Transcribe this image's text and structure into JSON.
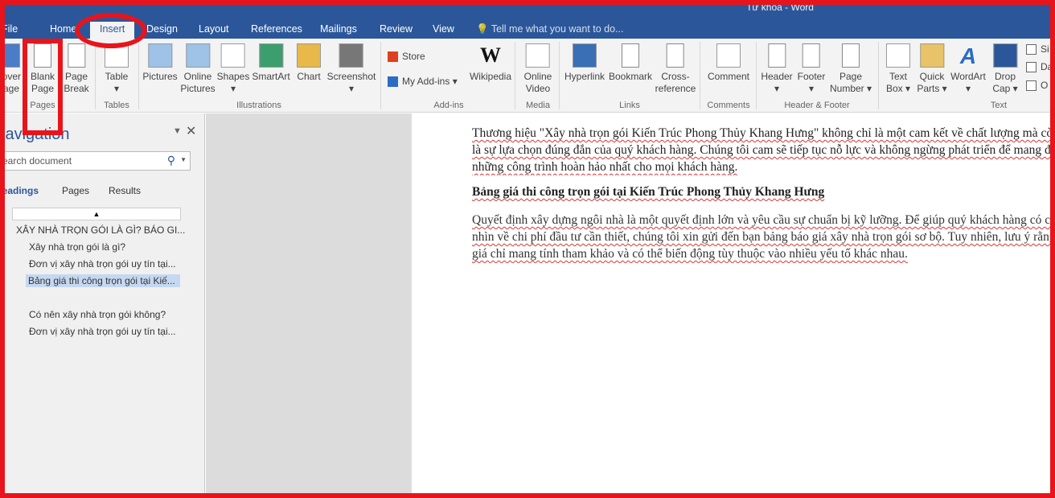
{
  "window": {
    "title": "Từ khóa - Word"
  },
  "tabs": [
    {
      "label": "File"
    },
    {
      "label": "Home"
    },
    {
      "label": "Insert"
    },
    {
      "label": "Design"
    },
    {
      "label": "Layout"
    },
    {
      "label": "References"
    },
    {
      "label": "Mailings"
    },
    {
      "label": "Review"
    },
    {
      "label": "View"
    }
  ],
  "active_tab": "Insert",
  "tell_me": "Tell me what you want to do...",
  "ribbon": {
    "buttons": [
      {
        "label": "Cover\nPage",
        "icon": "cover-page-icon"
      },
      {
        "label": "Blank\nPage",
        "icon": "blank-page-icon"
      },
      {
        "label": "Page\nBreak",
        "icon": "page-break-icon"
      },
      {
        "label": "Table\n▾",
        "icon": "table-icon"
      },
      {
        "label": "Pictures",
        "icon": "pictures-icon"
      },
      {
        "label": "Online\nPictures",
        "icon": "online-pictures-icon"
      },
      {
        "label": "Shapes\n▾",
        "icon": "shapes-icon"
      },
      {
        "label": "SmartArt",
        "icon": "smartart-icon"
      },
      {
        "label": "Chart",
        "icon": "chart-icon"
      },
      {
        "label": "Screenshot\n▾",
        "icon": "screenshot-icon"
      },
      {
        "label": "Wikipedia",
        "icon": "wikipedia-icon"
      },
      {
        "label": "Online\nVideo",
        "icon": "online-video-icon"
      },
      {
        "label": "Hyperlink",
        "icon": "hyperlink-icon"
      },
      {
        "label": "Bookmark",
        "icon": "bookmark-icon"
      },
      {
        "label": "Cross-\nreference",
        "icon": "cross-reference-icon"
      },
      {
        "label": "Comment",
        "icon": "comment-icon"
      },
      {
        "label": "Header\n▾",
        "icon": "header-icon"
      },
      {
        "label": "Footer\n▾",
        "icon": "footer-icon"
      },
      {
        "label": "Page\nNumber ▾",
        "icon": "page-number-icon"
      },
      {
        "label": "Text\nBox ▾",
        "icon": "text-box-icon"
      },
      {
        "label": "Quick\nParts ▾",
        "icon": "quick-parts-icon"
      },
      {
        "label": "WordArt\n▾",
        "icon": "wordart-icon"
      },
      {
        "label": "Drop\nCap ▾",
        "icon": "drop-cap-icon"
      }
    ],
    "small": [
      {
        "label": "Store",
        "icon": "store-icon"
      },
      {
        "label": "My Add-ins  ▾",
        "icon": "my-addins-icon"
      },
      {
        "label": "Si",
        "icon": "signature-line-icon"
      },
      {
        "label": "Da",
        "icon": "date-time-icon"
      },
      {
        "label": "O",
        "icon": "object-icon"
      }
    ],
    "groups": [
      "Pages",
      "Tables",
      "Illustrations",
      "Add-ins",
      "Media",
      "Links",
      "Comments",
      "Header & Footer",
      "Text"
    ]
  },
  "navigation": {
    "title": "Navigation",
    "search_placeholder": "Search document",
    "tabs": [
      "Headings",
      "Pages",
      "Results"
    ],
    "headings": [
      "XÂY NHÀ TRỌN GÓI LÀ GÌ? BÁO GI...",
      "Xây nhà trọn gói là gì?",
      "Đơn vị xây nhà trọn gói uy tín tại...",
      "Bảng giá thi công trọn gói tại Kiế...",
      "Có nên xây nhà trọn gói không?",
      "Đơn vị xây nhà trọn gói uy tín tại..."
    ],
    "selected_heading": 3
  },
  "document": {
    "p1": "Thương hiệu \"Xây nhà trọn gói Kiến Trúc Phong Thủy Khang Hưng\" không chỉ là một cam kết về chất lượng mà còn là sự lựa chọn đúng đắn của quý khách hàng. Chúng tôi cam sẽ tiếp tục nỗ lực và không ngừng phát triển để mang đến những công trình hoàn hảo nhất cho mọi khách hàng.",
    "heading": "Bảng giá thi công trọn gói tại Kiến Trúc Phong Thủy Khang Hưng",
    "p2": "Quyết định xây dựng ngôi nhà là một quyết định lớn và yêu cầu sự chuẩn bị kỹ lưỡng. Để giúp quý khách hàng có cái nhìn về chi phí đầu tư cần thiết, chúng tôi xin gửi đến bạn bảng báo giá xây nhà trọn gói sơ bộ. Tuy nhiên, lưu ý rằng giá chỉ mang tính tham khảo và có thể biến động tùy thuộc vào nhiều yếu tố khác nhau."
  },
  "colors": {
    "titlebar": "#2b579a",
    "annotation": "#e8141b"
  }
}
